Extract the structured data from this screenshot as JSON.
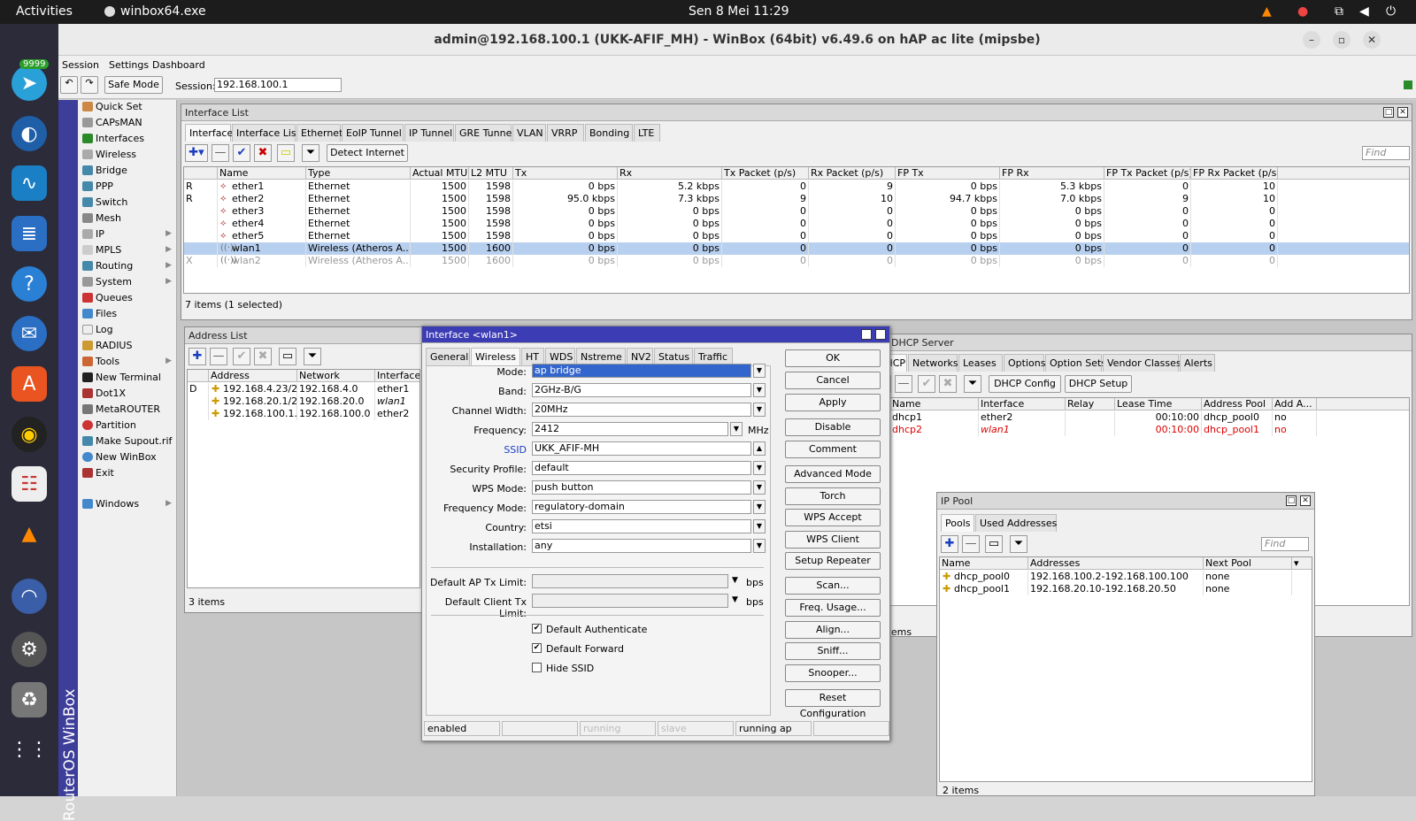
{
  "topbar": {
    "activities": "Activities",
    "app": "winbox64.exe",
    "clock": "Sen 8 Mei  11:29"
  },
  "dock": {
    "badge": "9999"
  },
  "window": {
    "title": "admin@192.168.100.1 (UKK-AFIF_MH) - WinBox (64bit) v6.49.6 on hAP ac lite (mipsbe)"
  },
  "menu": [
    "Session",
    "Settings",
    "Dashboard"
  ],
  "toolbar": {
    "safe_mode": "Safe Mode",
    "session_label": "Session:",
    "session_value": "192.168.100.1"
  },
  "vertical_label": "RouterOS WinBox",
  "sidebar": [
    "Quick Set",
    "CAPsMAN",
    "Interfaces",
    "Wireless",
    "Bridge",
    "PPP",
    "Switch",
    "Mesh",
    "IP",
    "MPLS",
    "Routing",
    "System",
    "Queues",
    "Files",
    "Log",
    "RADIUS",
    "Tools",
    "New Terminal",
    "Dot1X",
    "MetaROUTER",
    "Partition",
    "Make Supout.rif",
    "New WinBox",
    "Exit",
    "Windows"
  ],
  "iface": {
    "title": "Interface List",
    "tabs": [
      "Interface",
      "Interface List",
      "Ethernet",
      "EoIP Tunnel",
      "IP Tunnel",
      "GRE Tunnel",
      "VLAN",
      "VRRP",
      "Bonding",
      "LTE"
    ],
    "detect": "Detect Internet",
    "find": "Find",
    "columns": [
      "Name",
      "Type",
      "Actual MTU",
      "L2 MTU",
      "Tx",
      "Rx",
      "Tx Packet (p/s)",
      "Rx Packet (p/s)",
      "FP Tx",
      "FP Rx",
      "FP Tx Packet (p/s)",
      "FP Rx Packet (p/s)"
    ],
    "rows": [
      [
        "R",
        "ether1",
        "Ethernet",
        "1500",
        "1598",
        "0 bps",
        "5.2 kbps",
        "0",
        "9",
        "0 bps",
        "5.3 kbps",
        "0",
        "10"
      ],
      [
        "R",
        "ether2",
        "Ethernet",
        "1500",
        "1598",
        "95.0 kbps",
        "7.3 kbps",
        "9",
        "10",
        "94.7 kbps",
        "7.0 kbps",
        "9",
        "10"
      ],
      [
        "",
        "ether3",
        "Ethernet",
        "1500",
        "1598",
        "0 bps",
        "0 bps",
        "0",
        "0",
        "0 bps",
        "0 bps",
        "0",
        "0"
      ],
      [
        "",
        "ether4",
        "Ethernet",
        "1500",
        "1598",
        "0 bps",
        "0 bps",
        "0",
        "0",
        "0 bps",
        "0 bps",
        "0",
        "0"
      ],
      [
        "",
        "ether5",
        "Ethernet",
        "1500",
        "1598",
        "0 bps",
        "0 bps",
        "0",
        "0",
        "0 bps",
        "0 bps",
        "0",
        "0"
      ],
      [
        "",
        "wlan1",
        "Wireless (Atheros A...",
        "1500",
        "1600",
        "0 bps",
        "0 bps",
        "0",
        "0",
        "0 bps",
        "0 bps",
        "0",
        "0"
      ],
      [
        "X",
        "wlan2",
        "Wireless (Atheros A...",
        "1500",
        "1600",
        "0 bps",
        "0 bps",
        "0",
        "0",
        "0 bps",
        "0 bps",
        "0",
        "0"
      ]
    ],
    "status": "7 items (1 selected)"
  },
  "addr": {
    "title": "Address List",
    "columns": [
      "Address",
      "Network",
      "Interface"
    ],
    "rows": [
      [
        "D",
        "192.168.4.23/24",
        "192.168.4.0",
        "ether1"
      ],
      [
        "",
        "192.168.20.1/24",
        "192.168.20.0",
        "wlan1"
      ],
      [
        "",
        "192.168.100.1...",
        "192.168.100.0",
        "ether2"
      ]
    ],
    "status": "3 items"
  },
  "dhcp": {
    "title": "DHCP Server",
    "tabs": [
      "DHCP",
      "Networks",
      "Leases",
      "Options",
      "Option Sets",
      "Vendor Classes",
      "Alerts"
    ],
    "config": "DHCP Config",
    "setup": "DHCP Setup",
    "columns": [
      "Name",
      "Interface",
      "Relay",
      "Lease Time",
      "Address Pool",
      "Add A..."
    ],
    "rows": [
      [
        "dhcp1",
        "ether2",
        "",
        "00:10:00",
        "dhcp_pool0",
        "no"
      ],
      [
        "dhcp2",
        "wlan1",
        "",
        "00:10:00",
        "dhcp_pool1",
        "no"
      ]
    ],
    "status": "2 items"
  },
  "pool": {
    "title": "IP Pool",
    "tabs": [
      "Pools",
      "Used Addresses"
    ],
    "find": "Find",
    "columns": [
      "Name",
      "Addresses",
      "Next Pool"
    ],
    "rows": [
      [
        "dhcp_pool0",
        "192.168.100.2-192.168.100.100",
        "none"
      ],
      [
        "dhcp_pool1",
        "192.168.20.10-192.168.20.50",
        "none"
      ]
    ],
    "status": "2 items"
  },
  "dialog": {
    "title": "Interface <wlan1>",
    "tabs": [
      "General",
      "Wireless",
      "HT",
      "WDS",
      "Nstreme",
      "NV2",
      "Status",
      "Traffic"
    ],
    "fields": [
      {
        "label": "Mode:",
        "value": "ap bridge"
      },
      {
        "label": "Band:",
        "value": "2GHz-B/G"
      },
      {
        "label": "Channel Width:",
        "value": "20MHz"
      },
      {
        "label": "Frequency:",
        "value": "2412",
        "unit": "MHz"
      },
      {
        "label": "SSID",
        "value": "UKK_AFIF-MH"
      },
      {
        "label": "Security Profile:",
        "value": "default"
      },
      {
        "label": "WPS Mode:",
        "value": "push button"
      },
      {
        "label": "Frequency Mode:",
        "value": "regulatory-domain"
      },
      {
        "label": "Country:",
        "value": "etsi"
      },
      {
        "label": "Installation:",
        "value": "any"
      }
    ],
    "limits": [
      {
        "label": "Default AP Tx Limit:",
        "unit": "bps"
      },
      {
        "label": "Default Client Tx Limit:",
        "unit": "bps"
      }
    ],
    "checks": [
      {
        "label": "Default Authenticate",
        "checked": true
      },
      {
        "label": "Default Forward",
        "checked": true
      },
      {
        "label": "Hide SSID",
        "checked": false
      }
    ],
    "buttons": [
      "OK",
      "Cancel",
      "Apply",
      "Disable",
      "Comment",
      "Advanced Mode",
      "Torch",
      "WPS Accept",
      "WPS Client",
      "Setup Repeater",
      "Scan...",
      "Freq. Usage...",
      "Align...",
      "Sniff...",
      "Snooper...",
      "Reset Configuration"
    ],
    "statusbar": [
      "enabled",
      "",
      "running",
      "slave",
      "running ap",
      ""
    ]
  }
}
